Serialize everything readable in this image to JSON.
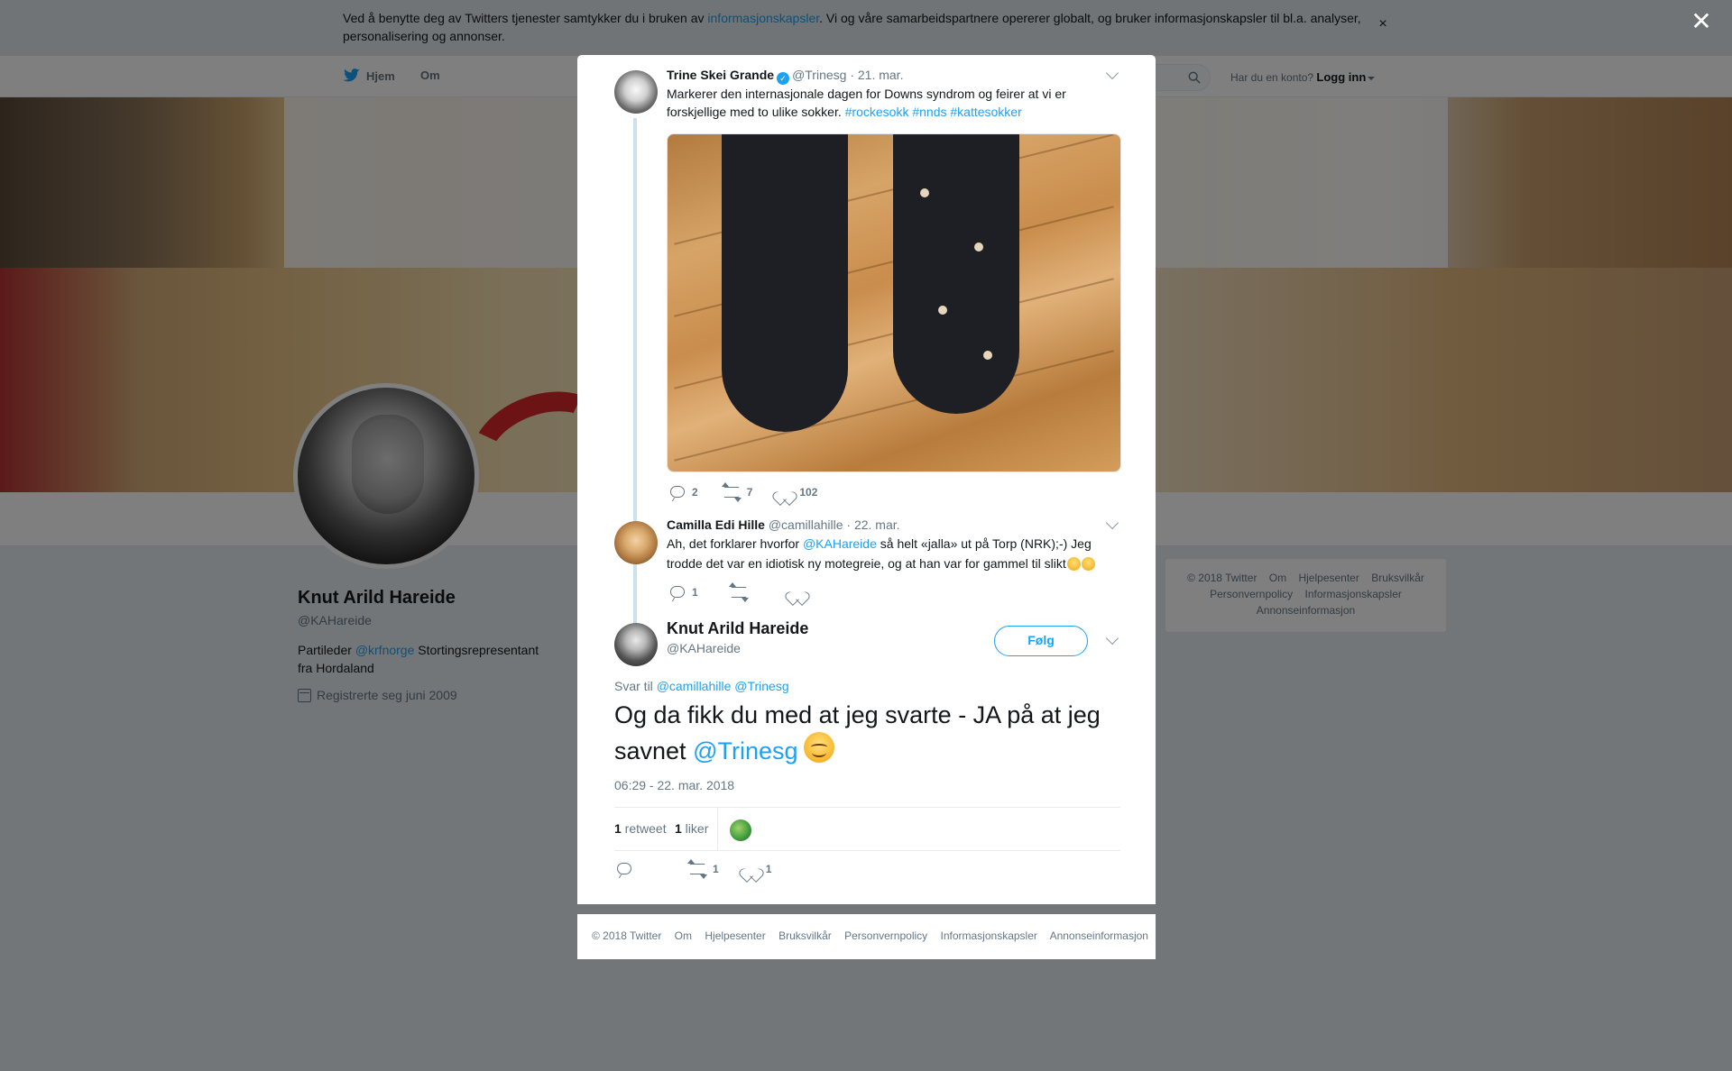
{
  "cookie": {
    "text_before": "Ved å benytte deg av Twitters tjenester samtykker du i bruken av ",
    "link": "informasjonskapsler",
    "text_after": ". Vi og våre samarbeidspartnere opererer globalt, og bruker informasjonskapsler til bl.a. analyser, personalisering og annonser.",
    "close": "×"
  },
  "nav": {
    "home": "Hjem",
    "about": "Om",
    "login_question": "Har du en konto?",
    "login": "Logg inn"
  },
  "profile": {
    "name": "Knut Arild Hareide",
    "handle": "@KAHareide",
    "bio_before": "Partileder ",
    "bio_link": "@krfnorge",
    "bio_after": " Stortingsrepresentant fra Hordaland",
    "joined": "Registrerte seg juni 2009"
  },
  "side_footer": [
    "© 2018 Twitter",
    "Om",
    "Hjelpesenter",
    "Bruksvilkår",
    "Personvernpolicy",
    "Informasjonskapsler",
    "Annonseinformasjon"
  ],
  "overlay_close": "✕",
  "tweet1": {
    "name": "Trine Skei Grande",
    "verified_mark": "✓",
    "handle": "@Trinesg",
    "date": "· 21. mar.",
    "text": "Markerer den internasjonale dagen for Downs syndrom og feirer at vi er forskjellige med to ulike sokker. ",
    "hashtags": "#rockesokk #nnds #kattesokker",
    "replies": "2",
    "retweets": "7",
    "likes": "102"
  },
  "tweet2": {
    "name": "Camilla Edi Hille",
    "handle": "@camillahille",
    "date": "· 22. mar.",
    "text_before": "Ah, det forklarer hvorfor ",
    "mention": "@KAHareide",
    "text_after": "  så helt «jalla» ut på Torp (NRK);-) Jeg trodde det var en idiotisk ny motegreie, og at han var for gammel til slikt",
    "replies": "1"
  },
  "main_tweet": {
    "name": "Knut Arild Hareide",
    "handle": "@KAHareide",
    "follow": "Følg",
    "reply_label": "Svar til ",
    "reply_mentions": "@camillahille @Trinesg",
    "text": "Og da fikk du med at jeg svarte - JA på at jeg savnet ",
    "mention": "@Trinesg",
    "timestamp": "06:29 - 22. mar. 2018",
    "retweet_count": "1",
    "retweet_label": " retweet",
    "like_count": "1",
    "like_label": " liker",
    "action_retweets": "1",
    "action_likes": "1"
  },
  "modal_footer": [
    "© 2018 Twitter",
    "Om",
    "Hjelpesenter",
    "Bruksvilkår",
    "Personvernpolicy",
    "Informasjonskapsler",
    "Annonseinformasjon"
  ],
  "colors": {
    "accent": "#1da1f2",
    "text": "#14171a",
    "muted": "#657786",
    "thread": "#cce1ef"
  }
}
